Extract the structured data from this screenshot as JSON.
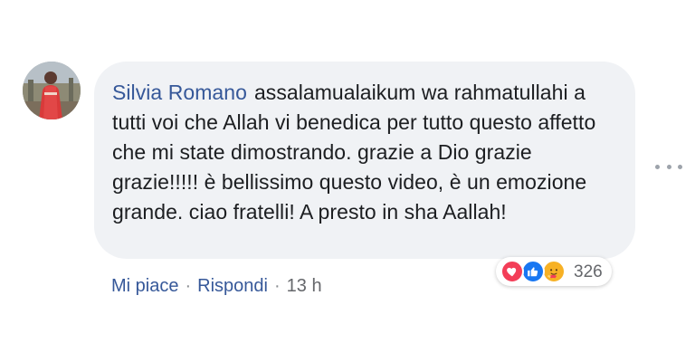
{
  "comment": {
    "author": "Silvia Romano",
    "text": "assalamualaikum wa rahmatullahi a tutti voi che Allah vi benedica per tutto questo affetto che mi state dimostrando. grazie a Dio grazie grazie!!!!! è bellissimo questo video, è un emozione grande. ciao fratelli! A presto in sha Aallah!"
  },
  "reactions": {
    "icons": [
      "love-icon",
      "like-icon",
      "care-icon"
    ],
    "count": "326"
  },
  "actions": {
    "like_label": "Mi piace",
    "reply_label": "Rispondi",
    "separator": "·",
    "timestamp": "13 h"
  },
  "colors": {
    "link": "#365899",
    "bubble": "#f0f2f5",
    "love": "#f33e58",
    "like": "#1877f2",
    "care": "#f7b125"
  }
}
